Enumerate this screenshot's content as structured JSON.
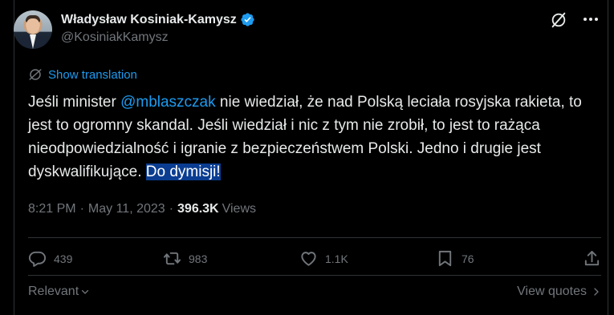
{
  "author": {
    "display_name": "Władysław Kosiniak-Kamysz",
    "handle": "@KosiniakKamysz"
  },
  "translate": {
    "label": "Show translation"
  },
  "tweet": {
    "text_part1": "Jeśli minister ",
    "mention": "@mblaszczak",
    "text_part2": " nie wiedział, że nad Polską leciała rosyjska rakieta, to jest to ogromny skandal. Jeśli wiedział i nic z tym nie zrobił, to jest to rażąca nieodpowiedzialność i igranie z bezpieczeństwem Polski. Jedno i drugie jest dyskwalifikujące. ",
    "text_selected": "Do dymisji!"
  },
  "meta": {
    "time": "8:21 PM",
    "separator": "·",
    "date": "May 11, 2023",
    "views_count": "396.3K",
    "views_label": "Views"
  },
  "actions": {
    "replies": "439",
    "reposts": "983",
    "likes": "1.1K",
    "bookmarks": "76"
  },
  "footer": {
    "sort_label": "Relevant",
    "quotes_label": "View quotes"
  },
  "icons": {
    "verified": "verified-badge-icon",
    "grok": "grok-icon",
    "more": "more-icon",
    "translate": "globe-icon",
    "reply": "reply-icon",
    "repost": "repost-icon",
    "like": "heart-icon",
    "bookmark": "bookmark-icon",
    "share": "share-icon"
  },
  "colors": {
    "background": "#000000",
    "text": "#e7e9ea",
    "muted": "#71767b",
    "accent": "#1d9bf0",
    "selection": "#0a3d91",
    "divider": "#2f3336"
  }
}
